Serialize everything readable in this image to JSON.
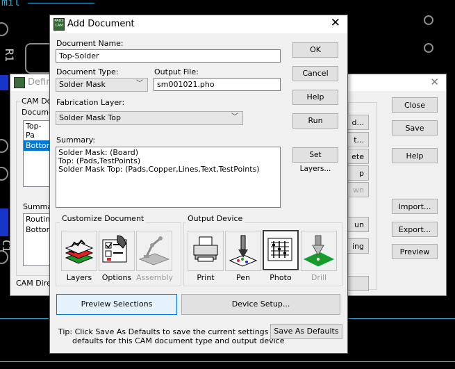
{
  "background": {
    "labels": [
      "mil",
      "R1",
      "C1"
    ]
  },
  "back_dialog": {
    "title": "Define",
    "cam_doc_label": "CAM Do",
    "document_label": "Documen",
    "documents": [
      "Top-Pa",
      "Bottom-"
    ],
    "summary_label": "Summar",
    "summary_lines": [
      "Routing",
      "Bottom:"
    ],
    "cam_dir_label": "CAM Direc",
    "middle_buttons": [
      "d...",
      "t...",
      "ete",
      "p",
      "wn",
      "un",
      "ing"
    ],
    "right_buttons": [
      "Close",
      "Save",
      "Help",
      "Import...",
      "Export...",
      "Preview"
    ]
  },
  "dialog": {
    "title": "Add Document",
    "document_name_label": "Document Name:",
    "document_name_value": "Top-Solder",
    "document_type_label": "Document Type:",
    "document_type_value": "Solder Mask",
    "output_file_label": "Output File:",
    "output_file_value": "sm001021.pho",
    "fabrication_layer_label": "Fabrication Layer:",
    "fabrication_layer_value": "Solder Mask Top",
    "summary_label": "Summary:",
    "summary_lines": [
      "Solder Mask: (Board)",
      "Top: (Pads,TestPoints)",
      "Solder Mask Top: (Pads,Copper,Lines,Text,TestPoints)"
    ],
    "buttons": {
      "ok": "OK",
      "cancel": "Cancel",
      "help": "Help",
      "run": "Run",
      "set_layers": "Set Layers..."
    },
    "customize_title": "Customize Document",
    "customize_items": [
      {
        "label": "Layers",
        "icon": "layers-icon",
        "enabled": true
      },
      {
        "label": "Options",
        "icon": "options-icon",
        "enabled": true
      },
      {
        "label": "Assembly",
        "icon": "assembly-icon",
        "enabled": false
      }
    ],
    "output_title": "Output Device",
    "output_items": [
      {
        "label": "Print",
        "icon": "printer-icon",
        "enabled": true,
        "selected": false
      },
      {
        "label": "Pen",
        "icon": "pen-plotter-icon",
        "enabled": true,
        "selected": false
      },
      {
        "label": "Photo",
        "icon": "photo-plotter-icon",
        "enabled": true,
        "selected": true
      },
      {
        "label": "Drill",
        "icon": "drill-icon",
        "enabled": false,
        "selected": false
      }
    ],
    "preview_selections": "Preview Selections",
    "device_setup": "Device Setup...",
    "tip_line1": "Tip: Click Save As Defaults to save the current settings as the",
    "tip_line2": "defaults for this CAM document type and output device",
    "save_as_defaults": "Save As Defaults"
  },
  "colors": {
    "focus_button": "#e5f1fb",
    "focus_border": "#0078d7",
    "selection": "#0078d7",
    "pcb_trace": "#1536c7"
  }
}
